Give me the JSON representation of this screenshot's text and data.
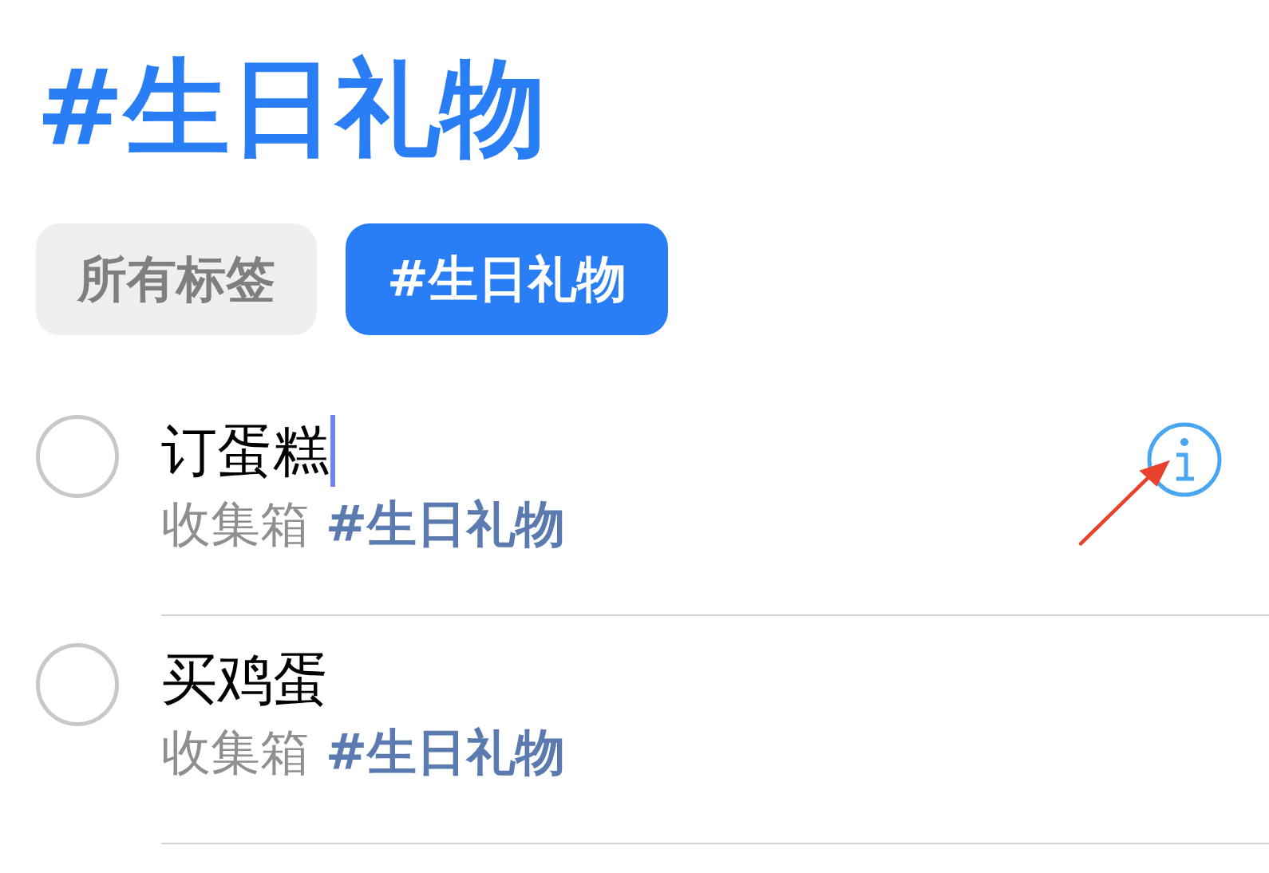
{
  "title": "#生日礼物",
  "tags": [
    {
      "label": "所有标签",
      "selected": false
    },
    {
      "label": "#生日礼物",
      "selected": true
    }
  ],
  "reminders": [
    {
      "title": "订蛋糕",
      "list": "收集箱",
      "tag": "#生日礼物",
      "completed": false,
      "editing": true
    },
    {
      "title": "买鸡蛋",
      "list": "收集箱",
      "tag": "#生日礼物",
      "completed": false,
      "editing": false
    }
  ]
}
